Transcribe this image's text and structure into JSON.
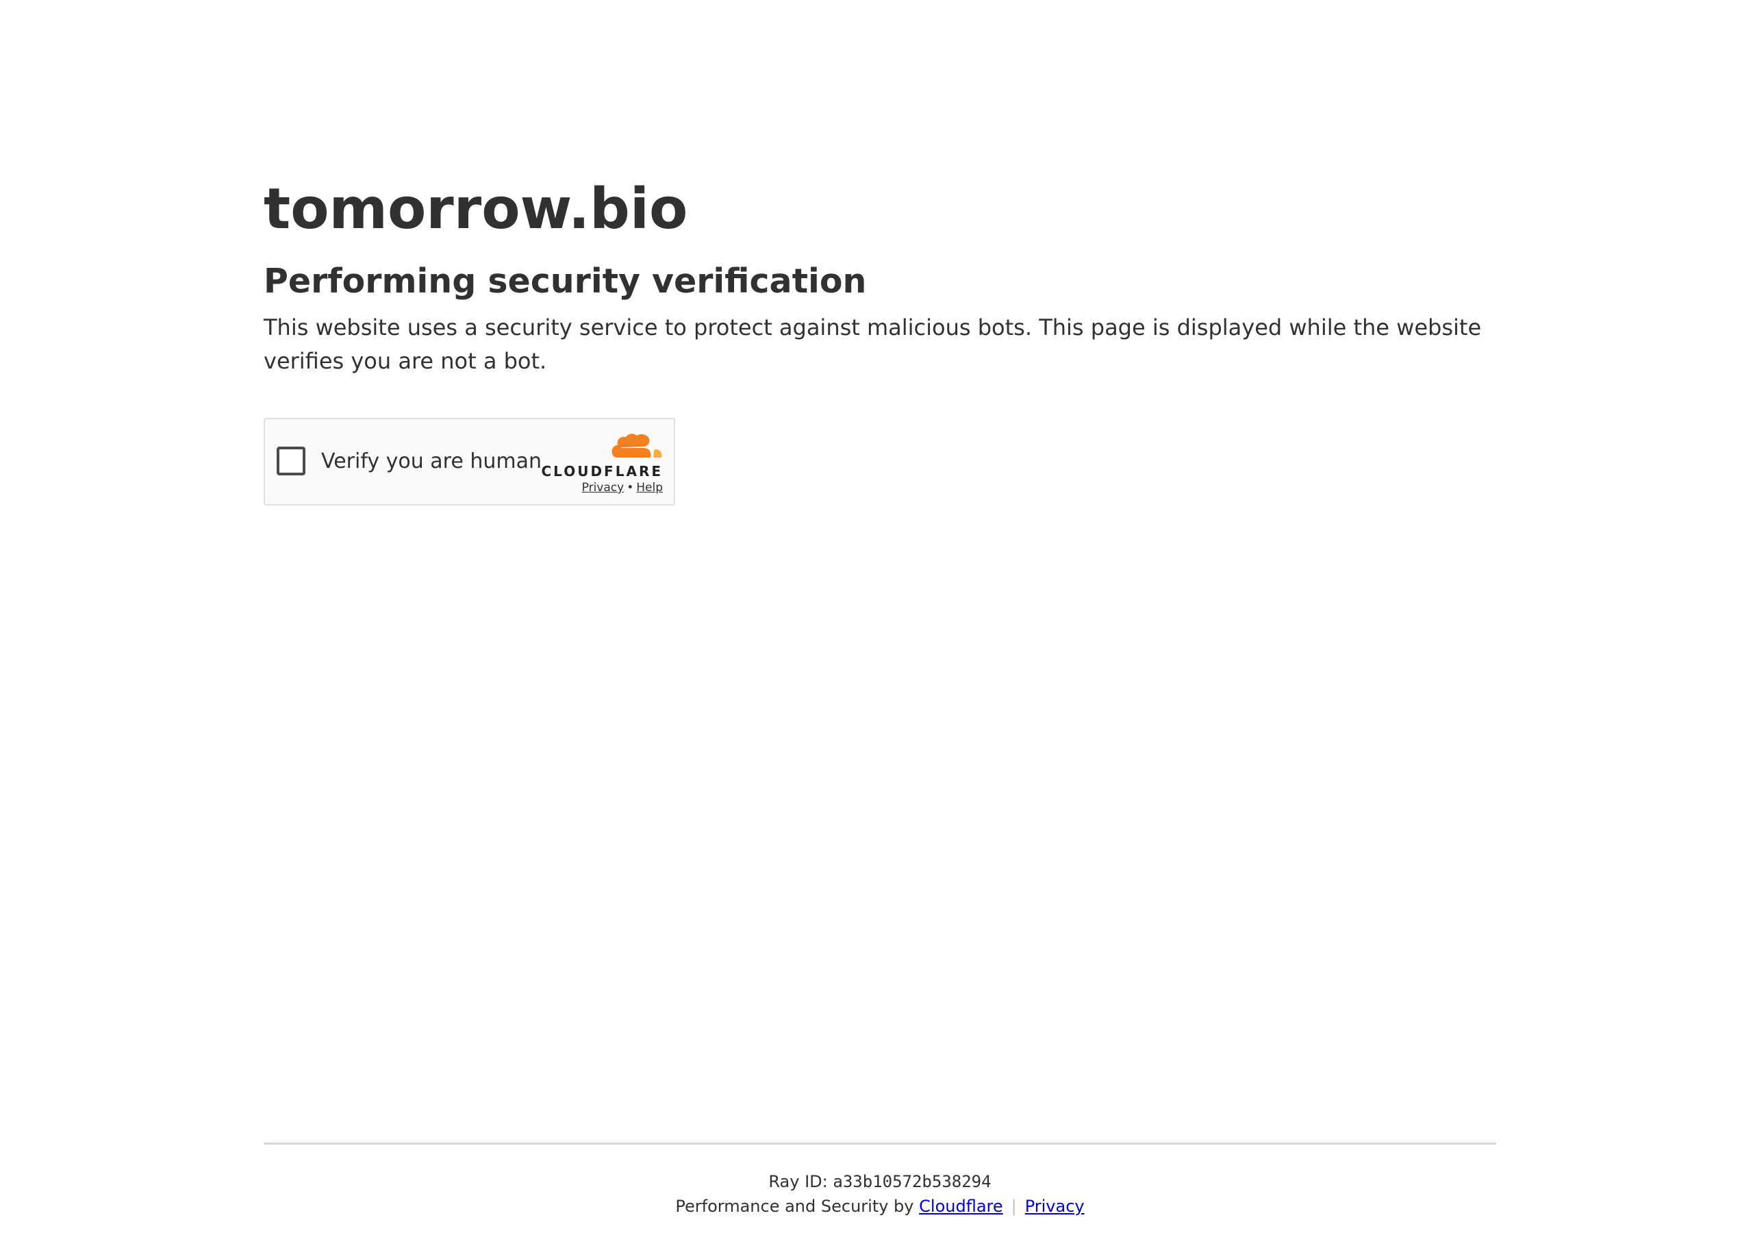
{
  "page": {
    "site_name": "tomorrow.bio",
    "heading": "Performing security verification",
    "description": "This website uses a security service to protect against malicious bots. This page is displayed while the website verifies you are not a bot."
  },
  "widget": {
    "checkbox_label": "Verify you are human",
    "checked": false,
    "brand_name": "CLOUDFLARE",
    "privacy_link": "Privacy",
    "link_separator": "•",
    "help_link": "Help",
    "brand_colors": {
      "orange": "#f38020",
      "light_orange": "#fbad41"
    }
  },
  "footer": {
    "ray_label": "Ray ID:",
    "ray_id": "a33b10572b538294",
    "performance_text": "Performance and Security by",
    "cloudflare_link": "Cloudflare",
    "separator": "|",
    "privacy_link": "Privacy",
    "link_color": "#0000cc"
  }
}
